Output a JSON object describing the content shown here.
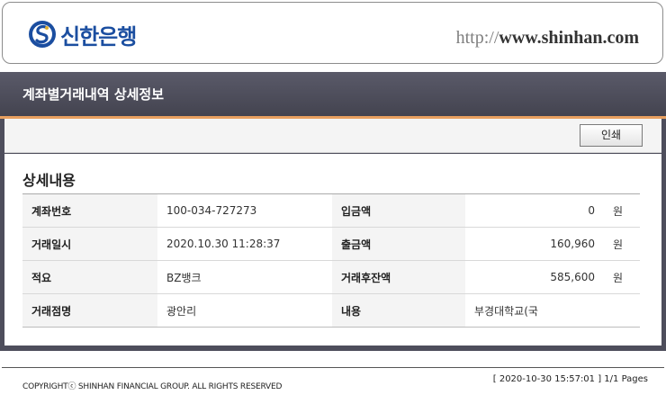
{
  "header": {
    "brand_name": "신한은행",
    "url_scheme": "http://",
    "url_host": "www.shinhan.com",
    "brand_color": "#1b4ea0"
  },
  "panel": {
    "title": "계좌별거래내역 상세정보",
    "print_label": "인쇄",
    "section_title": "상세내용"
  },
  "details": {
    "rows": [
      {
        "label1": "계좌번호",
        "value1": "100-034-727273",
        "label2": "입금액",
        "value2": "0",
        "unit2": "원"
      },
      {
        "label1": "거래일시",
        "value1": "2020.10.30 11:28:37",
        "label2": "출금액",
        "value2": "160,960",
        "unit2": "원"
      },
      {
        "label1": "적요",
        "value1": "BZ뱅크",
        "label2": "거래후잔액",
        "value2": "585,600",
        "unit2": "원"
      },
      {
        "label1": "거래점명",
        "value1": "광안리",
        "label2": "내용",
        "value2": "부경대학교(국",
        "unit2": ""
      }
    ]
  },
  "footer": {
    "copyright": "COPYRIGHTⓒ SHINHAN FINANCIAL GROUP. ALL RIGHTS RESERVED",
    "print_info": "[ 2020-10-30 15:57:01 ] 1/1 Pages"
  }
}
